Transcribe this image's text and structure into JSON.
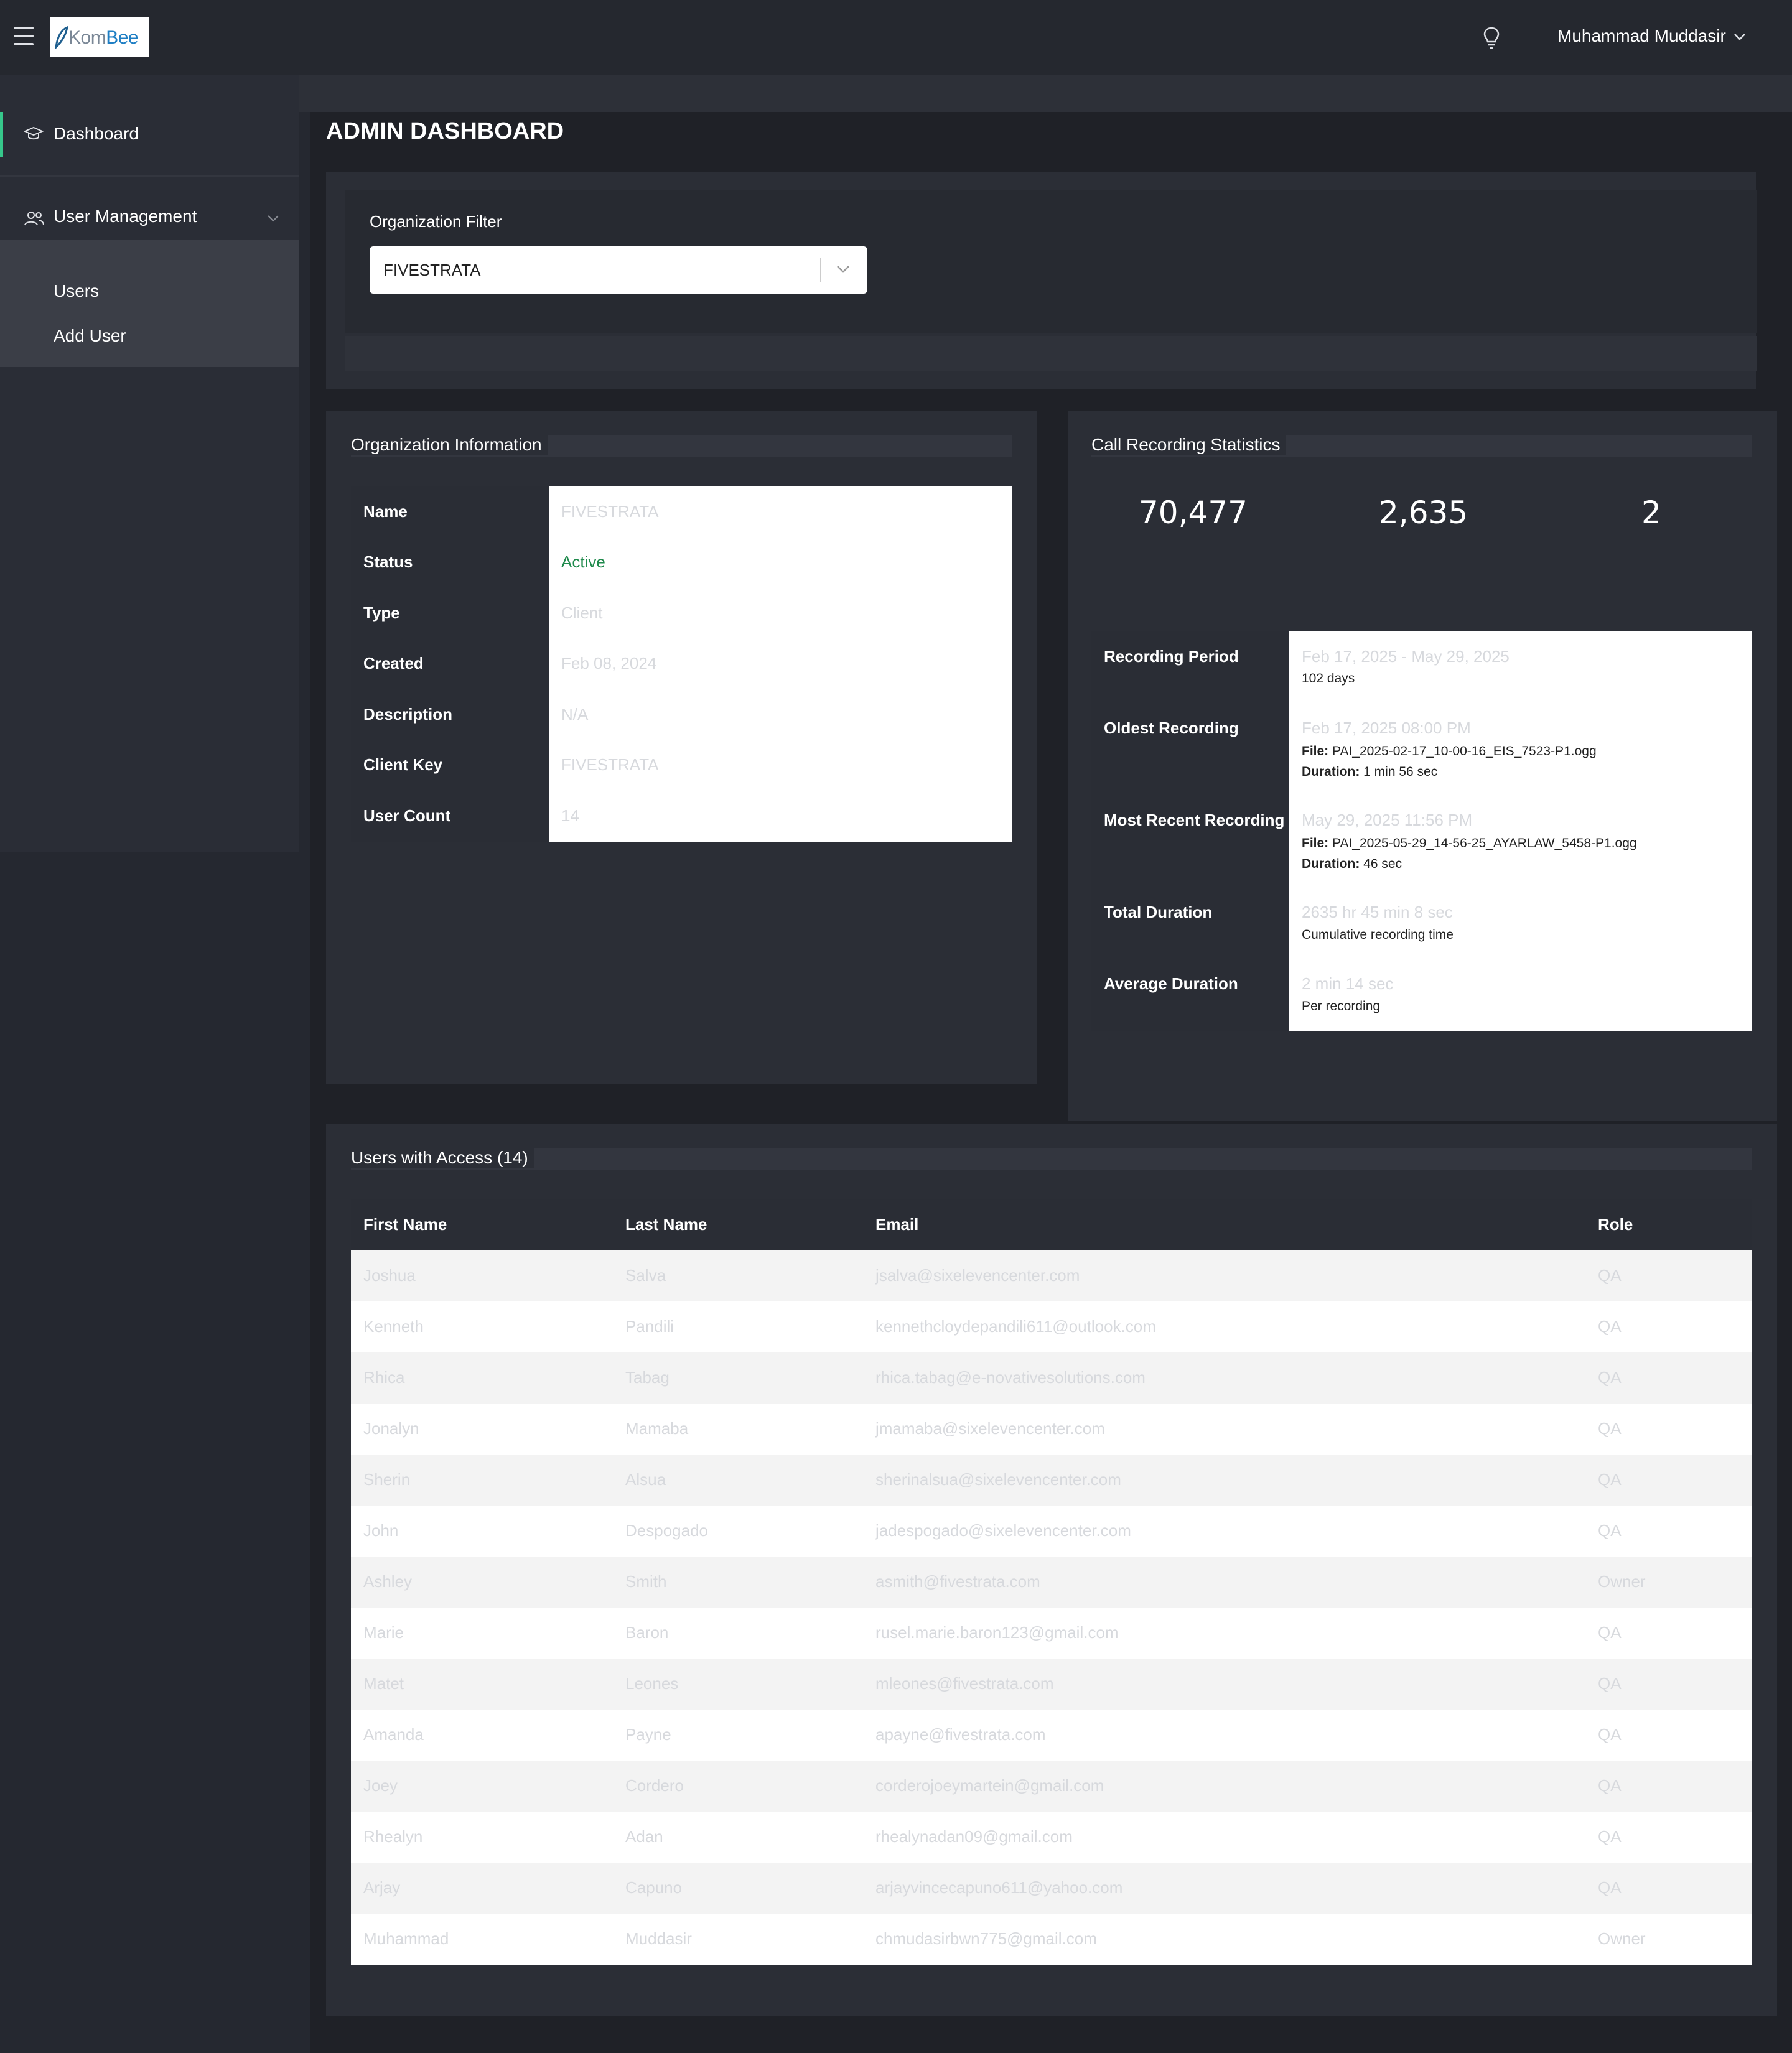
{
  "topbar": {
    "logo_text_part1": "Kom",
    "logo_text_part2": "Bee",
    "username": "Muhammad Muddasir"
  },
  "sidebar": {
    "dashboard_label": "Dashboard",
    "user_management_label": "User Management",
    "sub_items": [
      "Users",
      "Add User"
    ]
  },
  "page_title": "ADMIN DASHBOARD",
  "filter": {
    "label": "Organization Filter",
    "selected": "FIVESTRATA"
  },
  "org_info": {
    "title": "Organization Information",
    "rows": [
      {
        "key": "Name",
        "value": "FIVESTRATA"
      },
      {
        "key": "Status",
        "value": "Active"
      },
      {
        "key": "Type",
        "value": "Client"
      },
      {
        "key": "Created",
        "value": "Feb 08, 2024"
      },
      {
        "key": "Description",
        "value": "N/A"
      },
      {
        "key": "Client Key",
        "value": "FIVESTRATA"
      },
      {
        "key": "User Count",
        "value": "14"
      }
    ]
  },
  "stats": {
    "title": "Call Recording Statistics",
    "numbers": [
      "70,477",
      "2,635",
      "2"
    ],
    "rows": {
      "period": {
        "key": "Recording Period",
        "value": "Feb 17, 2025 - May 29, 2025",
        "sub": "102 days"
      },
      "oldest": {
        "key": "Oldest Recording",
        "value": "Feb 17, 2025 08:00 PM",
        "file_label": "File:",
        "file": "PAI_2025-02-17_10-00-16_EIS_7523-P1.ogg",
        "duration_label": "Duration:",
        "duration": "1 min 56 sec"
      },
      "recent": {
        "key": "Most Recent Recording",
        "value": "May 29, 2025 11:56 PM",
        "file_label": "File:",
        "file": "PAI_2025-05-29_14-56-25_AYARLAW_5458-P1.ogg",
        "duration_label": "Duration:",
        "duration": "46 sec"
      },
      "total": {
        "key": "Total Duration",
        "value": "2635 hr 45 min 8 sec",
        "sub": "Cumulative recording time"
      },
      "average": {
        "key": "Average Duration",
        "value": "2 min 14 sec",
        "sub": "Per recording"
      }
    }
  },
  "users": {
    "title": "Users with Access (14)",
    "columns": [
      "First Name",
      "Last Name",
      "Email",
      "Role"
    ],
    "rows": [
      [
        "Joshua",
        "Salva",
        "jsalva@sixelevencenter.com",
        "QA"
      ],
      [
        "Kenneth",
        "Pandili",
        "kennethcloydepandili611@outlook.com",
        "QA"
      ],
      [
        "Rhica",
        "Tabag",
        "rhica.tabag@e-novativesolutions.com",
        "QA"
      ],
      [
        "Jonalyn",
        "Mamaba",
        "jmamaba@sixelevencenter.com",
        "QA"
      ],
      [
        "Sherin",
        "Alsua",
        "sherinalsua@sixelevencenter.com",
        "QA"
      ],
      [
        "John",
        "Despogado",
        "jadespogado@sixelevencenter.com",
        "QA"
      ],
      [
        "Ashley",
        "Smith",
        "asmith@fivestrata.com",
        "Owner"
      ],
      [
        "Marie",
        "Baron",
        "rusel.marie.baron123@gmail.com",
        "QA"
      ],
      [
        "Matet",
        "Leones",
        "mleones@fivestrata.com",
        "QA"
      ],
      [
        "Amanda",
        "Payne",
        "apayne@fivestrata.com",
        "QA"
      ],
      [
        "Joey",
        "Cordero",
        "corderojoeymartein@gmail.com",
        "QA"
      ],
      [
        "Rhealyn",
        "Adan",
        "rhealynadan09@gmail.com",
        "QA"
      ],
      [
        "Arjay",
        "Capuno",
        "arjayvincecapuno611@yahoo.com",
        "QA"
      ],
      [
        "Muhammad",
        "Muddasir",
        "chmudasirbwn775@gmail.com",
        "Owner"
      ]
    ]
  }
}
